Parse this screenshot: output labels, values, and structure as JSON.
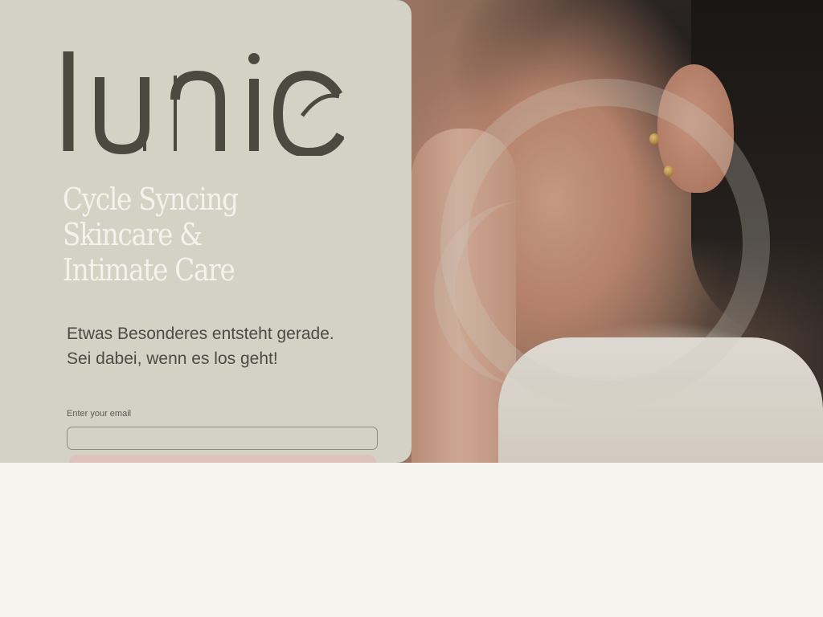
{
  "brand": {
    "logo_text": "lunie"
  },
  "hero": {
    "headline": [
      "Cycle Syncing",
      "Skincare &",
      "Intimate Care"
    ],
    "intro": "Etwas Besonderes entsteht gerade. Sei dabei, wenn es los geht!",
    "email_label": "Enter your email",
    "email_value": ""
  },
  "colors": {
    "panel_bg": "#d3d2c5",
    "logo": "#4b4a40",
    "headline": "#f4f2ec",
    "button": "#dcc2bb",
    "page_bg": "#f5f4ef"
  }
}
